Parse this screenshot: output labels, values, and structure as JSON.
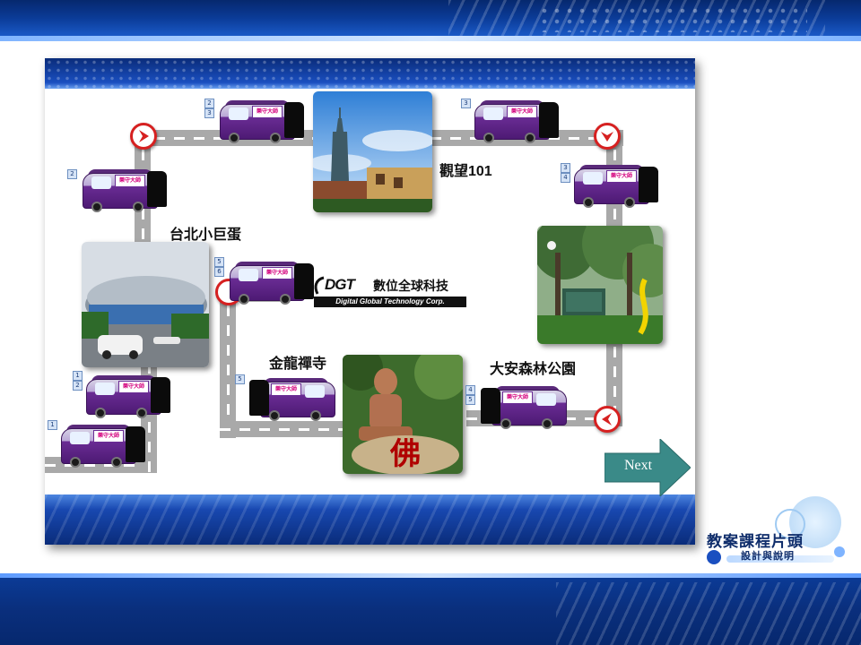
{
  "branding": {
    "title": "教案課程片頭",
    "subtitle": "設計與說明"
  },
  "slide": {
    "next_label": "Next",
    "locations": {
      "taipei101": "觀望101",
      "arena": "台北小巨蛋",
      "temple": "金龍禪寺",
      "park": "大安森林公園"
    },
    "logo": {
      "main": "DGT",
      "chinese": "數位全球科技",
      "english": "Digital Global Technology Corp."
    },
    "bus_logo_text": "樂守大師",
    "tags": {
      "t1": "1",
      "t2a": "1",
      "t2b": "2",
      "t3": "2",
      "t4a": "2",
      "t4b": "3",
      "t5": "3",
      "t6a": "3",
      "t6b": "4",
      "t7a": "4",
      "t7b": "5",
      "t8": "5",
      "t9a": "5",
      "t9b": "6"
    }
  },
  "colors": {
    "bus_purple": "#4d1a74",
    "road": "#a9a9a9",
    "sign_red": "#d62020",
    "next_arrow": "#3a8a88"
  }
}
